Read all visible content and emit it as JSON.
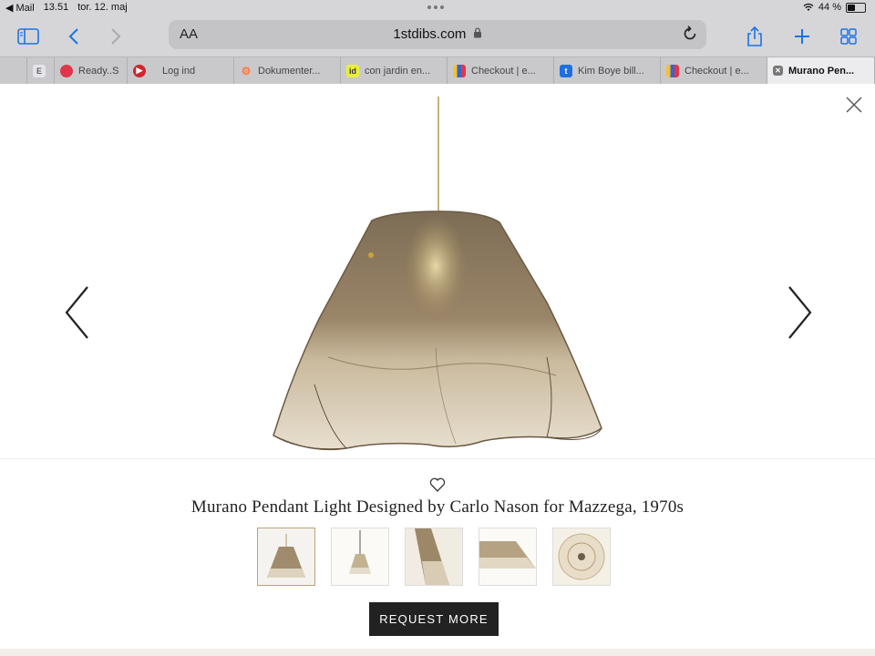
{
  "status_bar": {
    "back_app": "◀ Mail",
    "time": "13.51",
    "date": "tor. 12. maj",
    "battery": "44 %",
    "battery_level": 0.44
  },
  "toolbar": {
    "text_size_label": "AA",
    "url": "1stdibs.com",
    "icons": [
      "sidebar-icon",
      "back-icon",
      "forward-icon",
      "lock-icon",
      "reload-icon",
      "share-icon",
      "plus-icon",
      "tabs-grid-icon"
    ]
  },
  "tabs": [
    {
      "label": "",
      "favicon": "E",
      "color": "#e4e4ea"
    },
    {
      "label": "Ready..S",
      "favicon": "",
      "color": "#e0364b"
    },
    {
      "label": "Log ind",
      "favicon": "▶",
      "color": "#d0262f"
    },
    {
      "label": "Dokumenter...",
      "favicon": "",
      "color": "#ff7a3d"
    },
    {
      "label": "con jardin en...",
      "favicon": "id",
      "color": "#e8f036"
    },
    {
      "label": "Checkout | e...",
      "favicon": "",
      "color": "#3b63c9"
    },
    {
      "label": "Kim Boye bill...",
      "favicon": "t",
      "color": "#1d6fe0"
    },
    {
      "label": "Checkout | e...",
      "favicon": "",
      "color": "#3b63c9"
    },
    {
      "label": "Murano Pen...",
      "favicon": "✕",
      "color": "#777777",
      "active": true
    }
  ],
  "product": {
    "title": "Murano Pendant Light Designed by Carlo Nason for Mazzega, 1970s",
    "cta": "REQUEST MORE",
    "thumbnail_count": 5,
    "active_thumbnail": 0
  },
  "colors": {
    "accent": "#1a73e8",
    "glass_dark": "#8b7a62",
    "glass_light": "#e2d8c4",
    "cta_bg": "#222222"
  }
}
